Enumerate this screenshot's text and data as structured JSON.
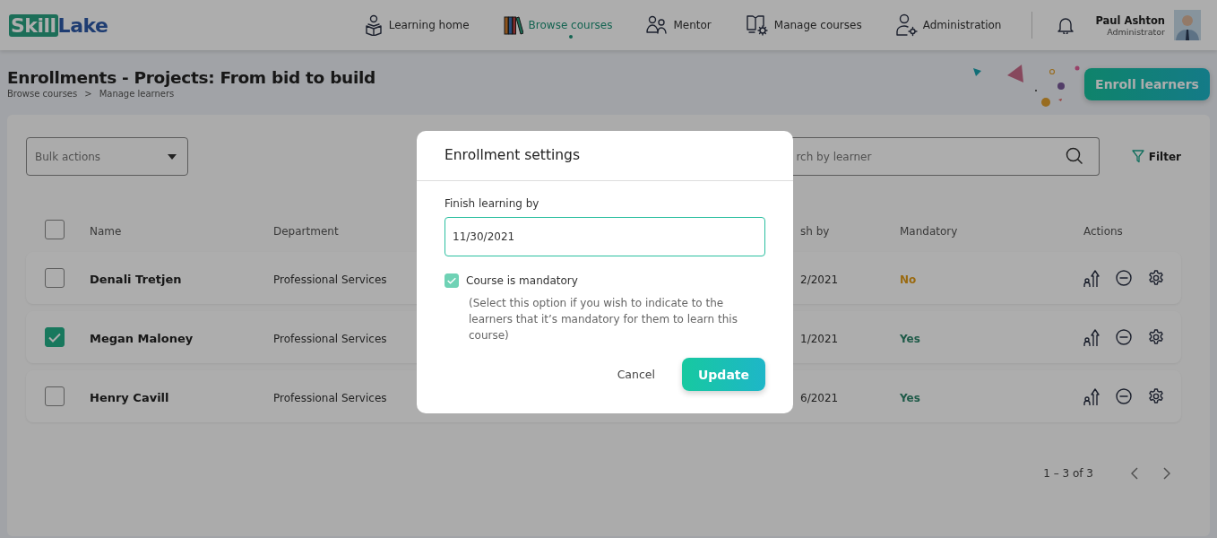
{
  "header": {
    "logo": [
      "Skill",
      "Lake"
    ],
    "nav": [
      {
        "label": "Learning home",
        "selected": false
      },
      {
        "label": "Browse courses",
        "selected": true
      },
      {
        "label": "Mentor",
        "selected": false
      },
      {
        "label": "Manage courses",
        "selected": false
      },
      {
        "label": "Administration",
        "selected": false
      }
    ],
    "user": {
      "name": "Paul Ashton",
      "role": "Administrator"
    }
  },
  "page": {
    "title": "Enrollments - Projects: From bid to build",
    "breadcrumbs": [
      "Browse courses",
      "Manage learners"
    ],
    "separator": ">",
    "enroll_button": "Enroll learners"
  },
  "toolbar": {
    "bulk_actions": {
      "placeholder": "Bulk actions"
    },
    "search": {
      "placeholder": "rch by learner"
    },
    "filter": "Filter"
  },
  "table": {
    "select_all": {
      "checked": false
    },
    "columns": [
      "Name",
      "Department",
      "sh by",
      "Mandatory",
      "Actions"
    ],
    "rows": [
      {
        "checked": false,
        "name": "Denali Tretjen",
        "department": "Professional Services",
        "finish_by": "2/2021",
        "mandatory": {
          "text": "No",
          "color": "#9a6a10"
        }
      },
      {
        "checked": true,
        "name": "Megan Maloney",
        "department": "Professional Services",
        "finish_by": "1/2021",
        "mandatory": {
          "text": "Yes",
          "color": "#1e5a48"
        }
      },
      {
        "checked": false,
        "name": "Henry Cavill",
        "department": "Professional Services",
        "finish_by": "6/2021",
        "mandatory": {
          "text": "Yes",
          "color": "#1e5a48"
        }
      }
    ]
  },
  "pagination": {
    "range": "1 – 3 of 3"
  },
  "modal": {
    "title": "Enrollment settings",
    "field_label": "Finish learning by",
    "field_value": "11/30/2021",
    "mandatory_checkbox": {
      "label": "Course is mandatory",
      "checked": true
    },
    "help": "(Select this option if you wish to indicate to the learners that it’s mandatory for them to learn this course)",
    "cancel": "Cancel",
    "update": "Update"
  }
}
